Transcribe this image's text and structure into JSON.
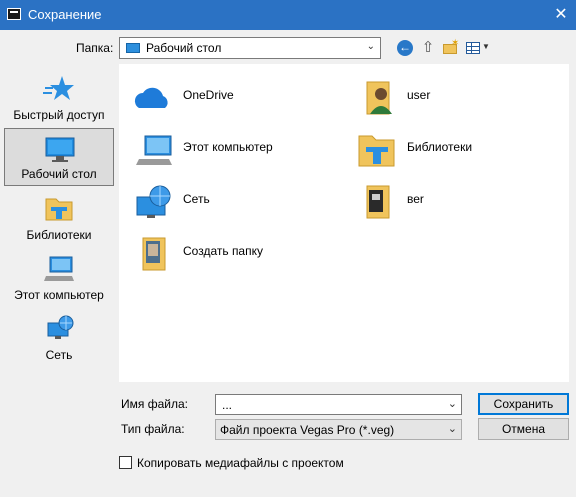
{
  "window": {
    "title": "Сохранение",
    "close_glyph": "✕"
  },
  "folder": {
    "label": "Папка:",
    "value": "Рабочий стол"
  },
  "toolbar": {
    "back_glyph": "←",
    "up_glyph": "⇧"
  },
  "places": [
    {
      "label": "Быстрый доступ",
      "icon": "quick-access-star-icon"
    },
    {
      "label": "Рабочий стол",
      "icon": "desktop-icon",
      "active": true
    },
    {
      "label": "Библиотеки",
      "icon": "libraries-icon"
    },
    {
      "label": "Этот компьютер",
      "icon": "computer-icon"
    },
    {
      "label": "Сеть",
      "icon": "network-icon"
    }
  ],
  "items": [
    {
      "label": "OneDrive",
      "icon": "onedrive-cloud-icon"
    },
    {
      "label": "user",
      "icon": "user-folder-icon"
    },
    {
      "label": "Этот компьютер",
      "icon": "computer-icon"
    },
    {
      "label": "Библиотеки",
      "icon": "libraries-folder-icon"
    },
    {
      "label": "Сеть",
      "icon": "network-icon"
    },
    {
      "label": "веr",
      "icon": "folder-with-files-icon"
    },
    {
      "label": "Создать папку",
      "icon": "folder-with-image-icon"
    }
  ],
  "filename": {
    "label": "Имя файла:",
    "value": "..."
  },
  "filetype": {
    "label": "Тип файла:",
    "value": "Файл проекта Vegas Pro (*.veg)"
  },
  "buttons": {
    "save": "Сохранить",
    "cancel": "Отмена"
  },
  "copy_media": {
    "label": "Копировать медиафайлы с проектом",
    "checked": false
  },
  "colors": {
    "titlebar": "#2b72c4",
    "accent": "#0078d7",
    "folder": "#f0c45c"
  }
}
